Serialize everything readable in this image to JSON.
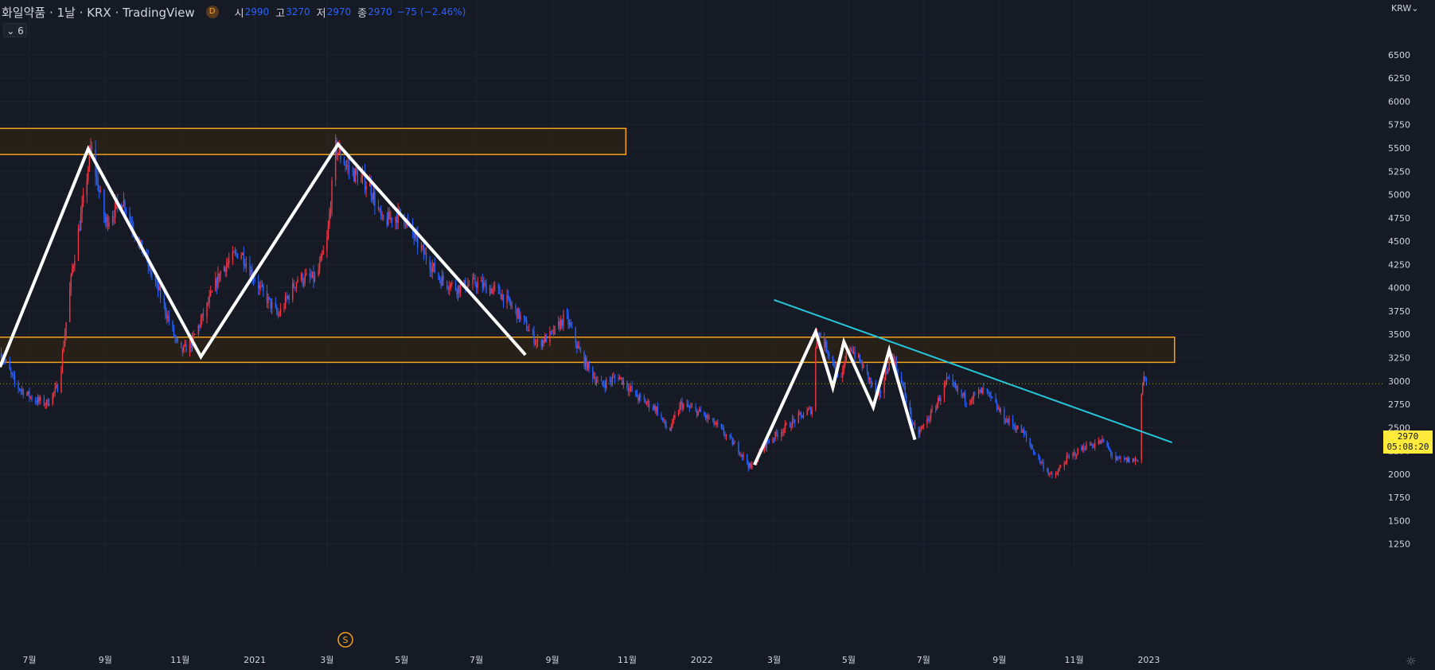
{
  "header": {
    "title": "화일약품 · 1날 · KRX · TradingView",
    "interval_badge": "D",
    "open_label": "시",
    "open_value": "2990",
    "high_label": "고",
    "high_value": "3270",
    "low_label": "저",
    "low_value": "2970",
    "close_label": "종",
    "close_value": "2970",
    "change": "−75 (−2.46%)"
  },
  "indicator_toggle": {
    "icon": "chevron-down-icon",
    "count": "6"
  },
  "currency_label": "KRW",
  "current_price": {
    "value": "2970",
    "countdown": "05:08:20"
  },
  "event_marker": "S",
  "colors": {
    "background": "#161a25",
    "grid": "#1f2330",
    "up_candle": "#f23645",
    "down_candle": "#2962ff",
    "zone_border": "#f7a21b",
    "zone_fill": "#2a2218",
    "pattern_line": "#ffffff",
    "trendline": "#26c6da",
    "axis_text": "#d1d4dc"
  },
  "chart_data": {
    "type": "candlestick",
    "y_axis": {
      "ylim": [
        1060,
        6900
      ],
      "ticks": [
        1250,
        1500,
        1750,
        2000,
        2250,
        2500,
        2750,
        3000,
        3250,
        3500,
        3750,
        4000,
        4250,
        4500,
        4750,
        5000,
        5250,
        5500,
        5750,
        6000,
        6250,
        6500
      ]
    },
    "x_axis": {
      "xlim": [
        "2020-06-07",
        "2023-02-10"
      ],
      "ticks": [
        {
          "date": "2020-07-01",
          "label": "7월"
        },
        {
          "date": "2020-09-01",
          "label": "9월"
        },
        {
          "date": "2020-11-01",
          "label": "11월"
        },
        {
          "date": "2021-01-01",
          "label": "2021"
        },
        {
          "date": "2021-03-01",
          "label": "3월"
        },
        {
          "date": "2021-05-01",
          "label": "5월"
        },
        {
          "date": "2021-07-01",
          "label": "7월"
        },
        {
          "date": "2021-09-01",
          "label": "9월"
        },
        {
          "date": "2021-11-01",
          "label": "11월"
        },
        {
          "date": "2022-01-01",
          "label": "2022"
        },
        {
          "date": "2022-03-01",
          "label": "3월"
        },
        {
          "date": "2022-05-01",
          "label": "5월"
        },
        {
          "date": "2022-07-01",
          "label": "7월"
        },
        {
          "date": "2022-09-01",
          "label": "9월"
        },
        {
          "date": "2022-11-01",
          "label": "11월"
        },
        {
          "date": "2023-01-01",
          "label": "2023"
        }
      ]
    },
    "price_path": [
      [
        "2020-06-08",
        3300
      ],
      [
        "2020-06-20",
        2950
      ],
      [
        "2020-07-05",
        2800
      ],
      [
        "2020-07-15",
        2760
      ],
      [
        "2020-07-25",
        2950
      ],
      [
        "2020-08-05",
        4200
      ],
      [
        "2020-08-15",
        5000
      ],
      [
        "2020-08-20",
        5500
      ],
      [
        "2020-09-01",
        4700
      ],
      [
        "2020-09-15",
        4950
      ],
      [
        "2020-10-01",
        4400
      ],
      [
        "2020-10-15",
        3950
      ],
      [
        "2020-11-01",
        3300
      ],
      [
        "2020-11-10",
        3400
      ],
      [
        "2020-11-20",
        3700
      ],
      [
        "2020-12-05",
        4200
      ],
      [
        "2020-12-20",
        4400
      ],
      [
        "2021-01-05",
        4000
      ],
      [
        "2021-01-20",
        3700
      ],
      [
        "2021-02-05",
        4100
      ],
      [
        "2021-02-20",
        4100
      ],
      [
        "2021-03-01",
        4500
      ],
      [
        "2021-03-08",
        5500
      ],
      [
        "2021-03-20",
        5250
      ],
      [
        "2021-04-05",
        5100
      ],
      [
        "2021-04-15",
        4700
      ],
      [
        "2021-05-01",
        4800
      ],
      [
        "2021-05-15",
        4450
      ],
      [
        "2021-06-01",
        4100
      ],
      [
        "2021-06-15",
        4000
      ],
      [
        "2021-07-01",
        4050
      ],
      [
        "2021-07-20",
        3950
      ],
      [
        "2021-08-05",
        3700
      ],
      [
        "2021-08-20",
        3400
      ],
      [
        "2021-09-01",
        3500
      ],
      [
        "2021-09-12",
        3700
      ],
      [
        "2021-09-25",
        3250
      ],
      [
        "2021-10-10",
        2950
      ],
      [
        "2021-10-25",
        3050
      ],
      [
        "2021-11-10",
        2820
      ],
      [
        "2021-11-25",
        2700
      ],
      [
        "2021-12-05",
        2450
      ],
      [
        "2021-12-15",
        2750
      ],
      [
        "2022-01-01",
        2650
      ],
      [
        "2022-01-15",
        2500
      ],
      [
        "2022-02-01",
        2250
      ],
      [
        "2022-02-10",
        2060
      ],
      [
        "2022-02-20",
        2300
      ],
      [
        "2022-03-05",
        2450
      ],
      [
        "2022-03-20",
        2600
      ],
      [
        "2022-04-01",
        2700
      ],
      [
        "2022-04-05",
        3550
      ],
      [
        "2022-04-15",
        3300
      ],
      [
        "2022-04-25",
        3000
      ],
      [
        "2022-05-01",
        3400
      ],
      [
        "2022-05-15",
        3100
      ],
      [
        "2022-05-25",
        2800
      ],
      [
        "2022-06-05",
        3300
      ],
      [
        "2022-06-15",
        2900
      ],
      [
        "2022-06-25",
        2400
      ],
      [
        "2022-07-10",
        2700
      ],
      [
        "2022-07-20",
        3000
      ],
      [
        "2022-08-05",
        2800
      ],
      [
        "2022-08-20",
        2900
      ],
      [
        "2022-09-05",
        2600
      ],
      [
        "2022-09-20",
        2450
      ],
      [
        "2022-10-01",
        2200
      ],
      [
        "2022-10-15",
        1950
      ],
      [
        "2022-10-25",
        2150
      ],
      [
        "2022-11-10",
        2300
      ],
      [
        "2022-11-25",
        2350
      ],
      [
        "2022-12-05",
        2150
      ],
      [
        "2022-12-15",
        2150
      ],
      [
        "2022-12-23",
        2150
      ],
      [
        "2022-12-26",
        2900
      ],
      [
        "2022-12-28",
        3050
      ],
      [
        "2022-12-30",
        2970
      ]
    ],
    "zones": [
      {
        "from": "2020-06-07",
        "to": "2021-10-31",
        "low": 5430,
        "high": 5710
      },
      {
        "from": "2020-06-07",
        "to": "2023-01-22",
        "low": 3200,
        "high": 3470
      }
    ],
    "pattern_lines": [
      [
        [
          "2020-06-07",
          3150
        ],
        [
          "2020-08-18",
          5490
        ],
        [
          "2020-11-18",
          3260
        ],
        [
          "2021-03-10",
          5540
        ],
        [
          "2021-08-10",
          3280
        ]
      ],
      [
        [
          "2022-02-13",
          2100
        ],
        [
          "2022-04-04",
          3530
        ],
        [
          "2022-04-18",
          2930
        ],
        [
          "2022-04-27",
          3420
        ],
        [
          "2022-05-21",
          2720
        ],
        [
          "2022-06-03",
          3330
        ],
        [
          "2022-06-24",
          2370
        ]
      ]
    ],
    "trendline": [
      [
        "2022-03-01",
        3870
      ],
      [
        "2023-01-20",
        2340
      ]
    ],
    "current_price": 2970,
    "event_date": "2021-03-16"
  }
}
